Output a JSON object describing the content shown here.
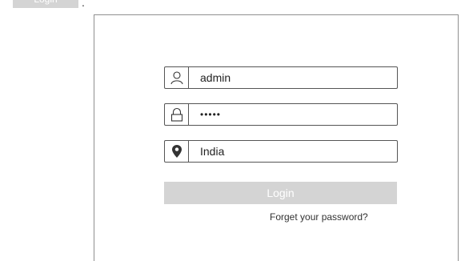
{
  "top": {
    "chip_label": "Login",
    "dot": "."
  },
  "form": {
    "username": {
      "value": "admin",
      "icon": "user-icon"
    },
    "password": {
      "value": "•••••",
      "icon": "lock-icon"
    },
    "location": {
      "value": "India",
      "icon": "location-pin-icon"
    },
    "login_label": "Login",
    "forgot_label": "Forget your password?"
  },
  "colors": {
    "border": "#555555",
    "panel_border": "#8f8f8f",
    "button_bg": "#d4d4d4",
    "button_text": "#ffffff"
  }
}
